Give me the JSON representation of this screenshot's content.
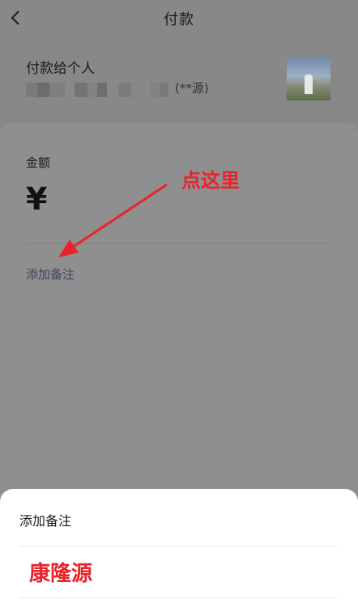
{
  "nav": {
    "title": "付款",
    "back_icon": "chevron-left-icon"
  },
  "payee": {
    "label": "付款给个人",
    "name_hint": "(**源)"
  },
  "amount": {
    "label": "金额",
    "currency_symbol": "¥"
  },
  "note": {
    "link_label": "添加备注"
  },
  "annotation": {
    "text": "点这里",
    "color": "#e8232b"
  },
  "sheet": {
    "title": "添加备注",
    "input_value": "康隆源"
  }
}
